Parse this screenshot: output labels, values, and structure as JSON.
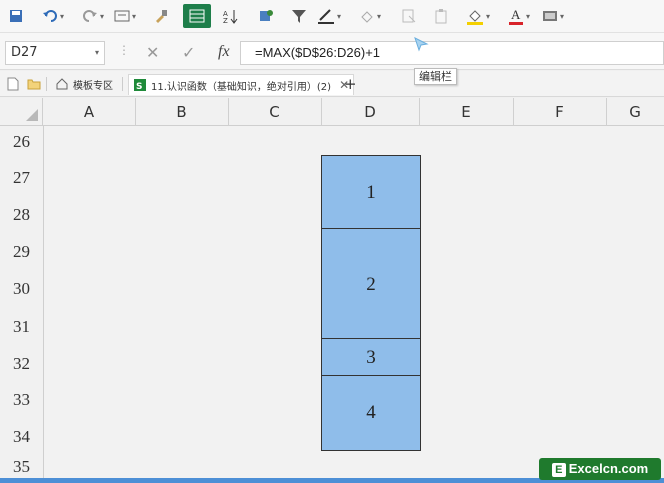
{
  "toolbar": {
    "icons": [
      "save-icon",
      "undo-icon",
      "redo-icon",
      "print-preview-icon",
      "format-painter-icon",
      "filter-grid-icon",
      "sort-icon",
      "freeze-icon",
      "filter-icon",
      "border-icon",
      "paint-icon",
      "clear-icon",
      "clipboard-icon",
      "fill-color-icon",
      "font-color-icon",
      "cell-style-icon"
    ]
  },
  "formula_bar": {
    "name_box": "D27",
    "cancel_glyph": "✕",
    "confirm_glyph": "✓",
    "fx_glyph": "fx",
    "formula": "=MAX($D$26:D26)+1",
    "tooltip": "编辑栏"
  },
  "tabs": {
    "template_tab": "模板专区",
    "doc_tab": "11.认识函数（基础知识，绝对引用）(2)",
    "add_tab": "+"
  },
  "columns": [
    "A",
    "B",
    "C",
    "D",
    "E",
    "F",
    "G"
  ],
  "rows": [
    "26",
    "27",
    "28",
    "29",
    "30",
    "31",
    "32",
    "33",
    "34",
    "35"
  ],
  "cells": {
    "d27": "1",
    "d29": "2",
    "d32": "3",
    "d33": "4"
  },
  "watermark": {
    "letter": "E",
    "text": "Excelcn.com"
  },
  "colors": {
    "cell_fill": "#8fbdea",
    "active_button": "#1e7e4a",
    "watermark_bg": "#1f7a2d"
  }
}
